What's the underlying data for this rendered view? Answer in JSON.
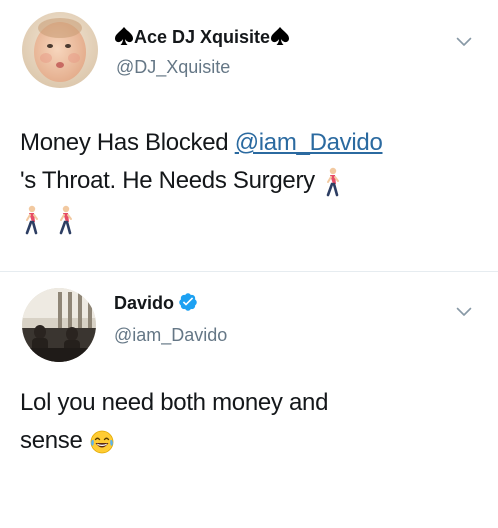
{
  "tweets": [
    {
      "display_name": "Ace DJ Xquisite",
      "handle": "@DJ_Xquisite",
      "avatar_icon": "baby-photo-avatar",
      "name_decor_icon": "spade-icon",
      "text_line1_before": "Money Has Blocked ",
      "mention": "@iam_Davido",
      "text_line2": "'s Throat. He Needs Surgery ",
      "emoji_icon": "person-walking-icon",
      "menu_icon": "chevron-down-icon"
    },
    {
      "display_name": "Davido",
      "handle": "@iam_Davido",
      "avatar_icon": "room-photo-avatar",
      "verified_icon": "verified-badge-icon",
      "text_line1": "Lol you need both money and",
      "text_line2": "sense ",
      "emoji_icon": "face-with-tears-of-joy-icon",
      "menu_icon": "chevron-down-icon"
    }
  ],
  "colors": {
    "name": "#14171a",
    "handle": "#657786",
    "mention": "#2b6aa0",
    "verified": "#1da1f2",
    "divider": "#e6ecf0"
  }
}
